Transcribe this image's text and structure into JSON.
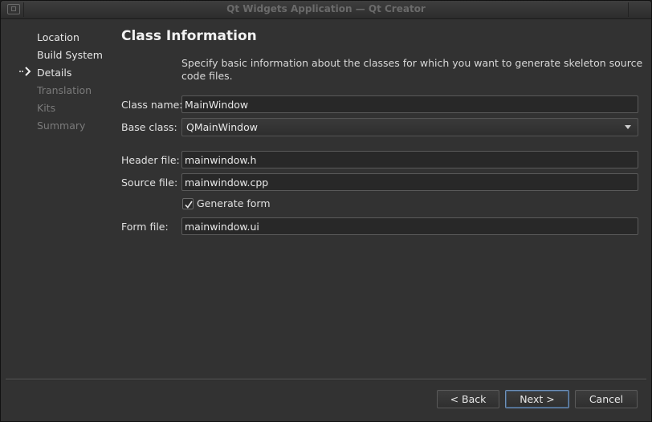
{
  "window": {
    "title": "Qt Widgets Application — Qt Creator"
  },
  "steps": [
    {
      "label": "Location",
      "state": "done"
    },
    {
      "label": "Build System",
      "state": "done"
    },
    {
      "label": "Details",
      "state": "current"
    },
    {
      "label": "Translation",
      "state": "pending"
    },
    {
      "label": "Kits",
      "state": "pending"
    },
    {
      "label": "Summary",
      "state": "pending"
    }
  ],
  "page": {
    "heading": "Class Information",
    "description": "Specify basic information about the classes for which you want to generate skeleton source code files."
  },
  "form": {
    "class_name": {
      "label": "Class name:",
      "value": "MainWindow"
    },
    "base_class": {
      "label": "Base class:",
      "value": "QMainWindow"
    },
    "header_file": {
      "label": "Header file:",
      "value": "mainwindow.h"
    },
    "source_file": {
      "label": "Source file:",
      "value": "mainwindow.cpp"
    },
    "generate_form": {
      "label": "Generate form",
      "checked": true
    },
    "form_file": {
      "label": "Form file:",
      "value": "mainwindow.ui"
    }
  },
  "buttons": {
    "back": "< Back",
    "next": "Next >",
    "cancel": "Cancel"
  },
  "icons": {
    "current_step": "arrow-right-icon",
    "window_menu": "window-menu-icon",
    "combo": "chevron-down-icon",
    "check": "checkmark-icon"
  },
  "colors": {
    "background": "#323232",
    "text": "#e6e6e6",
    "disabled_text": "#7a7a7a",
    "field_background": "#282828",
    "default_button_border": "#7090b8"
  }
}
